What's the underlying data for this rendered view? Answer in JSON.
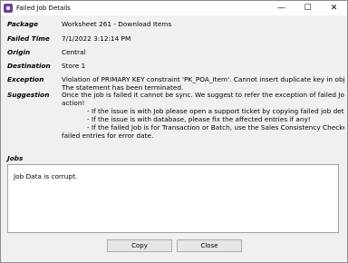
{
  "window": {
    "title": "Failed Job Details",
    "minimize": "—",
    "maximize": "☐",
    "close": "✕"
  },
  "fields": {
    "package_label": "Package",
    "package_value": "Worksheet 261 - Download Items",
    "failed_time_label": "Failed Time",
    "failed_time_value": "7/1/2022 3:12:14 PM",
    "origin_label": "Origin",
    "origin_value": "Central",
    "destination_label": "Destination",
    "destination_value": "Store 1",
    "exception_label": "Exception",
    "exception_line1": "Violation of PRIMARY KEY constraint 'PK_POA_Item'. Cannot insert duplicate key in object 'dbo.POA_Item'. The",
    "exception_line2": "The statement has been terminated.",
    "suggestion_label": "Suggestion",
    "suggestion_line1": "Once the job is failed it cannot be sync. We suggest to refer the exception of failed Job to take the necessary",
    "suggestion_line2": "action!",
    "suggestion_line3": "- If the issue is with Job please open a support ticket by copying failed job details to investigate!",
    "suggestion_line4": "- If the issue is with database, please fix the affected entries if any!",
    "suggestion_line5": "- If the failed Job is for Transaction or Batch, use the Sales Consistency Checker to sync the missing/",
    "suggestion_line6": "failed entries for error date."
  },
  "jobs": {
    "label": "Jobs",
    "content": "Job Data is corrupt."
  },
  "buttons": {
    "copy": "Copy",
    "close": "Close"
  }
}
